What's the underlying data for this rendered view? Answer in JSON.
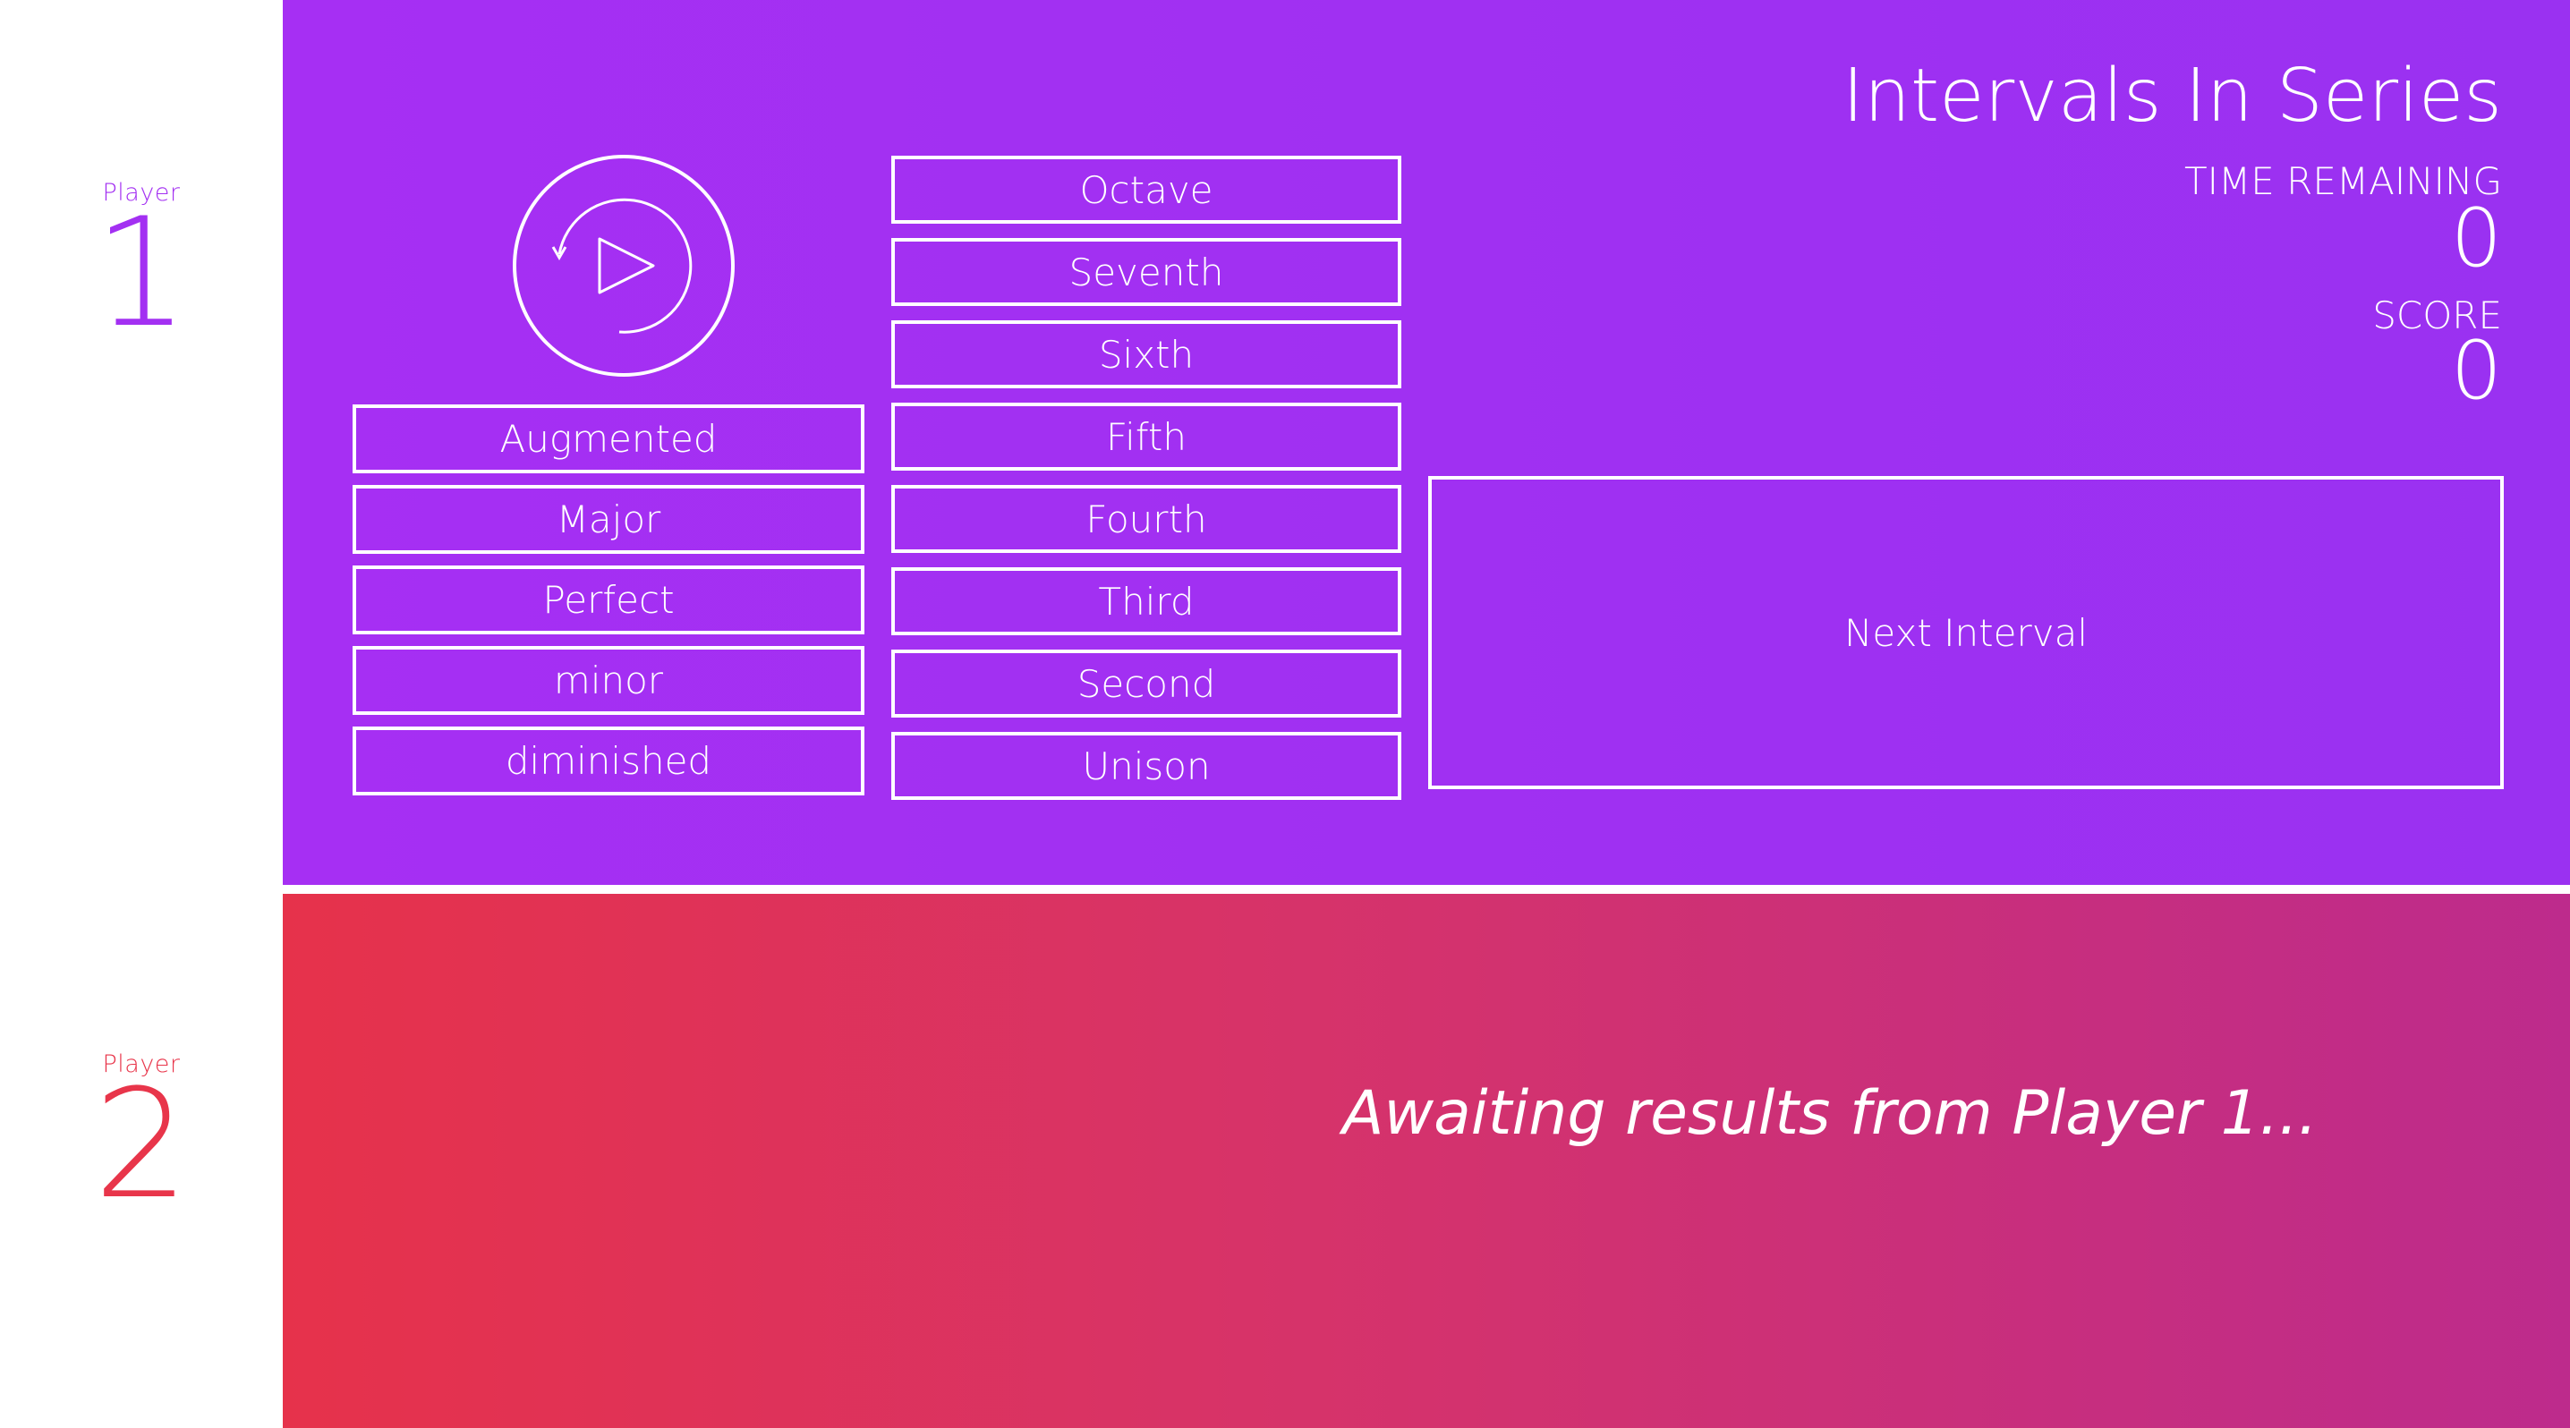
{
  "players": [
    {
      "label": "Player",
      "number": "1",
      "color": "#a330f2"
    },
    {
      "label": "Player",
      "number": "2",
      "color": "#e8354a"
    }
  ],
  "game": {
    "title": "Intervals In Series",
    "time_remaining_label": "TIME REMAINING",
    "time_remaining_value": "0",
    "score_label": "SCORE",
    "score_value": "0",
    "play_icon": "replay-play-icon"
  },
  "qualities": [
    "Augmented",
    "Major",
    "Perfect",
    "minor",
    "diminished"
  ],
  "numbers": [
    "Octave",
    "Seventh",
    "Sixth",
    "Fifth",
    "Fourth",
    "Third",
    "Second",
    "Unison"
  ],
  "next_button_label": "Next Interval",
  "player2_status": "Awaiting results from Player 1...",
  "colors": {
    "panel1": "#a62ff3",
    "panel2_start": "#e6324b",
    "panel2_end": "#bd2b8c"
  }
}
